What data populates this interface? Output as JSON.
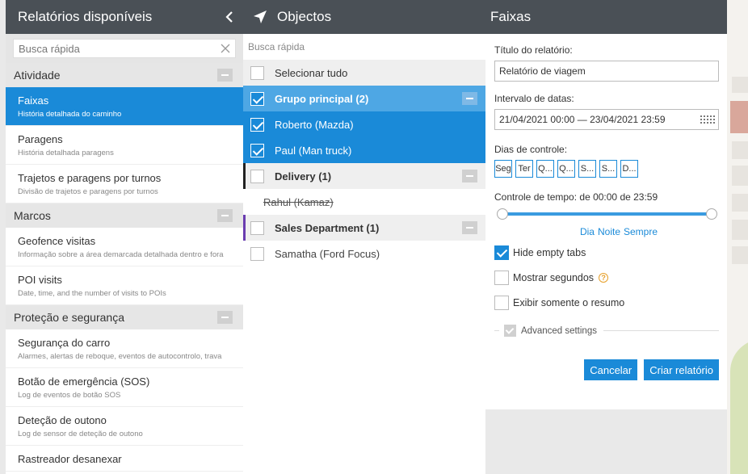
{
  "left": {
    "title": "Relatórios disponíveis",
    "search_placeholder": "Busca rápida",
    "categories": [
      {
        "label": "Atividade",
        "items": [
          {
            "title": "Faixas",
            "subtitle": "História detalhada do caminho",
            "active": true
          },
          {
            "title": "Paragens",
            "subtitle": "História detalhada paragens"
          },
          {
            "title": "Trajetos e paragens por turnos",
            "subtitle": "Divisão de trajetos e paragens por turnos"
          }
        ]
      },
      {
        "label": "Marcos",
        "items": [
          {
            "title": "Geofence visitas",
            "subtitle": "Informação sobre a área demarcada detalhada dentro e fora"
          },
          {
            "title": "POI visits",
            "subtitle": "Date, time, and the number of visits to POIs"
          }
        ]
      },
      {
        "label": "Proteção e segurança",
        "items": [
          {
            "title": "Segurança do carro",
            "subtitle": "Alarmes, alertas de reboque, eventos de autocontrolo, trava"
          },
          {
            "title": "Botão de emergência (SOS)",
            "subtitle": "Log de eventos de botão SOS"
          },
          {
            "title": "Deteção de outono",
            "subtitle": "Log de sensor de deteção de outono"
          },
          {
            "title": "Rastreador desanexar",
            "subtitle": ""
          }
        ]
      }
    ]
  },
  "mid": {
    "title": "Objectos",
    "search_placeholder": "Busca rápida",
    "select_all": "Selecionar tudo",
    "rows": [
      {
        "label": "Grupo principal (2)",
        "type": "group",
        "checked": true
      },
      {
        "label": "Roberto (Mazda)",
        "type": "child",
        "checked": true
      },
      {
        "label": "Paul (Man truck)",
        "type": "child",
        "checked": true
      },
      {
        "label": "Delivery (1)",
        "type": "group",
        "checked": false,
        "bar": "#222222"
      },
      {
        "label": "Rahul (Kamaz)",
        "type": "strike"
      },
      {
        "label": "Sales Department (1)",
        "type": "group",
        "checked": false,
        "bar": "#6a3db0"
      },
      {
        "label": "Samatha (Ford Focus)",
        "type": "child",
        "checked": false
      }
    ]
  },
  "right": {
    "title": "Faixas",
    "report_title_label": "Título do relatório:",
    "report_title_value": "Relatório de viagem",
    "date_label": "Intervalo de datas:",
    "date_value": "21/04/2021 00:00 — 23/04/2021 23:59",
    "days_label": "Dias de controle:",
    "days": [
      "Seg",
      "Ter",
      "Q...",
      "Q...",
      "S...",
      "S...",
      "D..."
    ],
    "time_label": "Controle de tempo: de 00:00 de 23:59",
    "presets": [
      "Dia",
      "Noite",
      "Sempre"
    ],
    "options": [
      {
        "label": "Hide empty tabs",
        "checked": true,
        "help": false
      },
      {
        "label": "Mostrar segundos",
        "checked": false,
        "help": true
      },
      {
        "label": "Exibir somente o resumo",
        "checked": false,
        "help": false
      }
    ],
    "advanced_label": "Advanced settings",
    "cancel_label": "Cancelar",
    "create_label": "Criar relatório"
  },
  "colors": {
    "accent": "#1a8ad8",
    "header": "#4a5056"
  }
}
